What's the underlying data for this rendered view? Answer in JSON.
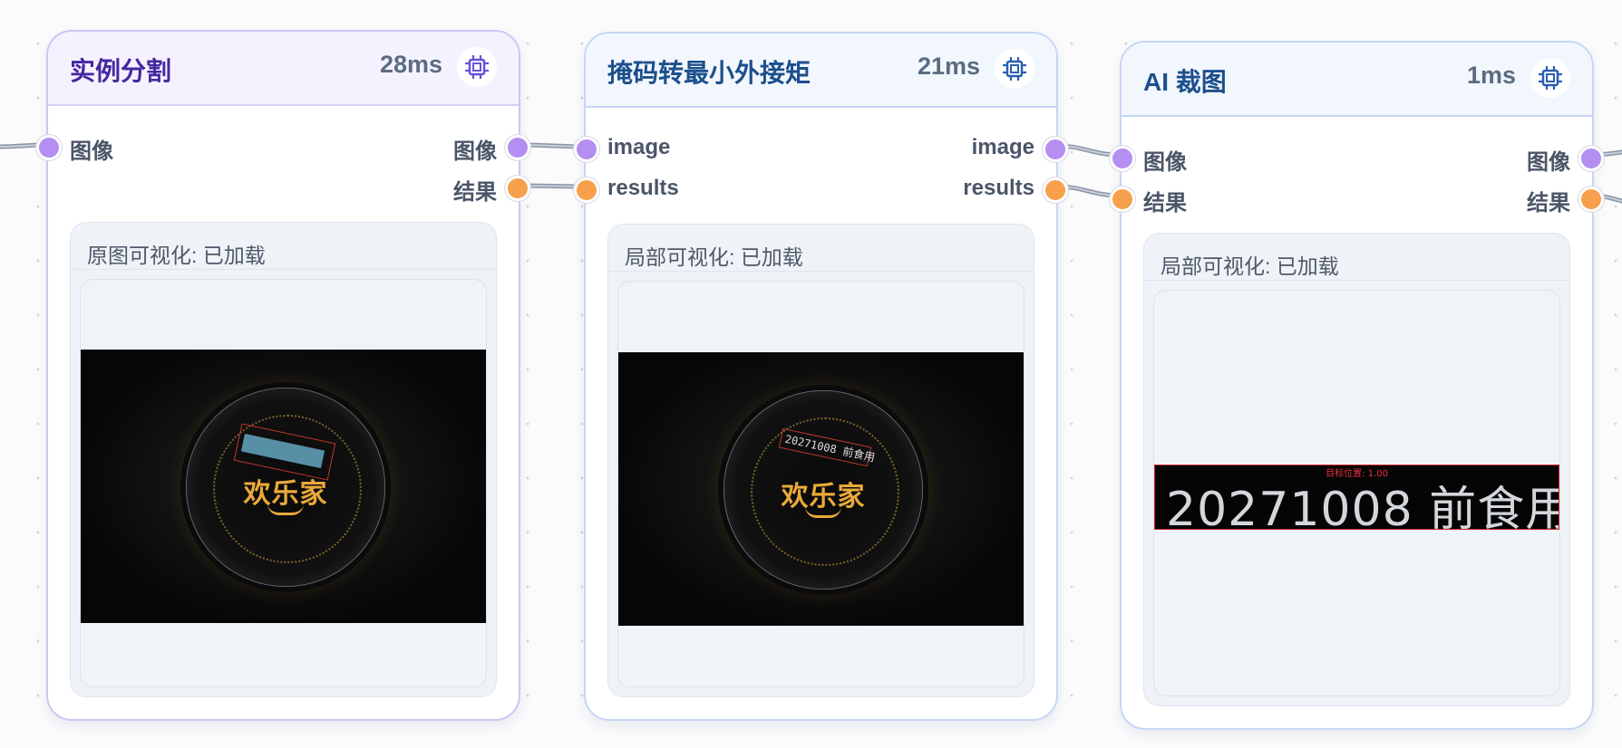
{
  "nodes": [
    {
      "title": "实例分割",
      "time": "28ms",
      "inputs": [
        "图像"
      ],
      "outputs": [
        "图像",
        "结果"
      ],
      "viz_title": "原图可视化: 已加载"
    },
    {
      "title": "掩码转最小外接矩",
      "time": "21ms",
      "inputs": [
        "image",
        "results"
      ],
      "outputs": [
        "image",
        "results"
      ],
      "viz_title": "局部可视化: 已加载",
      "overlay_text": "20271008 前食用"
    },
    {
      "title": "AI 裁图",
      "time": "1ms",
      "inputs": [
        "图像",
        "结果"
      ],
      "outputs": [
        "图像",
        "结果"
      ],
      "viz_title": "局部可视化: 已加载",
      "crop_text": "20271008 前食用",
      "crop_label": "目标位置: 1.00"
    }
  ],
  "logo_text": "欢乐家",
  "colors": {
    "port_image": "#b48ef0",
    "port_results": "#f7a04b",
    "title_blue": "#1c4f8c",
    "title_purple": "#4527a0"
  },
  "icons": {
    "node_action": "cpu-chip-icon"
  }
}
